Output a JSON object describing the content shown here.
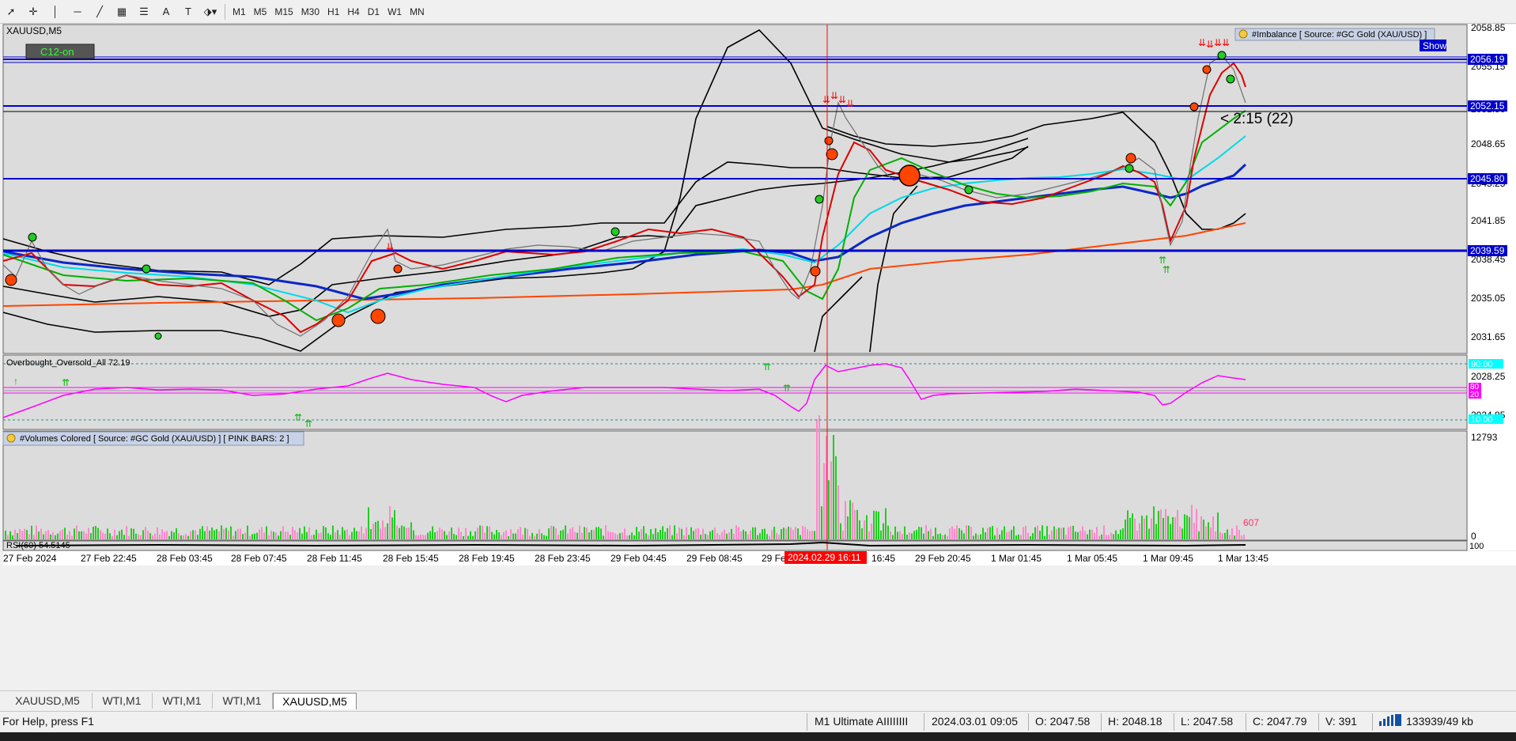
{
  "toolbar": {
    "tools": [
      {
        "name": "cursor-tool",
        "glyph": "➚"
      },
      {
        "name": "crosshair-tool",
        "glyph": "✛"
      },
      {
        "name": "vertical-line-tool",
        "glyph": "│"
      },
      {
        "name": "horizontal-line-tool",
        "glyph": "─"
      },
      {
        "name": "trendline-tool",
        "glyph": "╱"
      },
      {
        "name": "fibonacci-tool",
        "glyph": "▦"
      },
      {
        "name": "fibo-channel-tool",
        "glyph": "☰"
      },
      {
        "name": "text-tool",
        "glyph": "A"
      },
      {
        "name": "text-label-tool",
        "glyph": "T"
      },
      {
        "name": "shapes-tool",
        "glyph": "⬗▾"
      }
    ],
    "timeframes": [
      "M1",
      "M5",
      "M15",
      "M30",
      "H1",
      "H4",
      "D1",
      "W1",
      "MN"
    ]
  },
  "chart": {
    "symbol": "XAUUSD,M5",
    "badge": "C12-on",
    "imbalance_label": "#Imbalance [ Source: #GC Gold (XAU/USD) ]",
    "show_button": "Show",
    "countdown": "< 2:15 (22)",
    "price_ticks": [
      "2058.85",
      "2055.15",
      "2051.50",
      "2048.65",
      "2045.25",
      "2041.85",
      "2038.45",
      "2035.05",
      "2031.65",
      "2028.25",
      "2024.85"
    ],
    "hlines": [
      {
        "label": "2056.19",
        "color": "#0000cc"
      },
      {
        "label": "2052.15",
        "color": "#0000cc"
      },
      {
        "label": "2045.80",
        "color": "#0000cc"
      },
      {
        "label": "2039.59",
        "color": "#0000cc"
      }
    ],
    "time_ticks": [
      "27 Feb 2024",
      "27 Feb 22:45",
      "28 Feb 03:45",
      "28 Feb 07:45",
      "28 Feb 11:45",
      "28 Feb 15:45",
      "28 Feb 19:45",
      "28 Feb 23:45",
      "29 Feb 04:45",
      "29 Feb 08:45",
      "29 Fe",
      "16:45",
      "29 Feb 20:45",
      "1 Mar 01:45",
      "1 Mar 05:45",
      "1 Mar 09:45",
      "1 Mar 13:45"
    ],
    "crosshair_time": "2024.02.29 16:11"
  },
  "oscillator": {
    "label": "Overbought_Oversold_All 72.19",
    "level_top": "90.00",
    "level_80": "80",
    "level_20": "20",
    "level_bottom": "10.00"
  },
  "volume": {
    "label": "#Volumes Colored [ Source: #GC Gold (XAU/USD) ]  [ PINK BARS: 2 ]",
    "max_label": "12793",
    "zero_label": "0",
    "last_value": "607",
    "rsi_label": "RSI(60) 54.5145",
    "rsi_scale": "100"
  },
  "tabs": [
    "XAUUSD,M5",
    "WTI,M1",
    "WTI,M1",
    "WTI,M1",
    "XAUUSD,M5"
  ],
  "status": {
    "help": "For Help, press F1",
    "profile": "M1 Ultimate AIIIIIIII",
    "datetime": "2024.03.01 09:05",
    "open": "O: 2047.58",
    "high": "H: 2048.18",
    "low": "L: 2047.58",
    "close": "C: 2047.79",
    "volume": "V: 391",
    "traffic": "133939/49 kb"
  },
  "colors": {
    "chart_bg": "#dcdcdc",
    "level_line": "#0000cc",
    "fast_ma": "#dd0000",
    "mid_ma": "#00b000",
    "slow_ma": "#00d8e8",
    "trend_ma": "#0a28c8",
    "long_ma": "#ff4500",
    "oscillator": "#ff00ff",
    "volume_up": "#22cc22",
    "volume_down": "#ff88cc",
    "crosshair": "#ff0000"
  }
}
